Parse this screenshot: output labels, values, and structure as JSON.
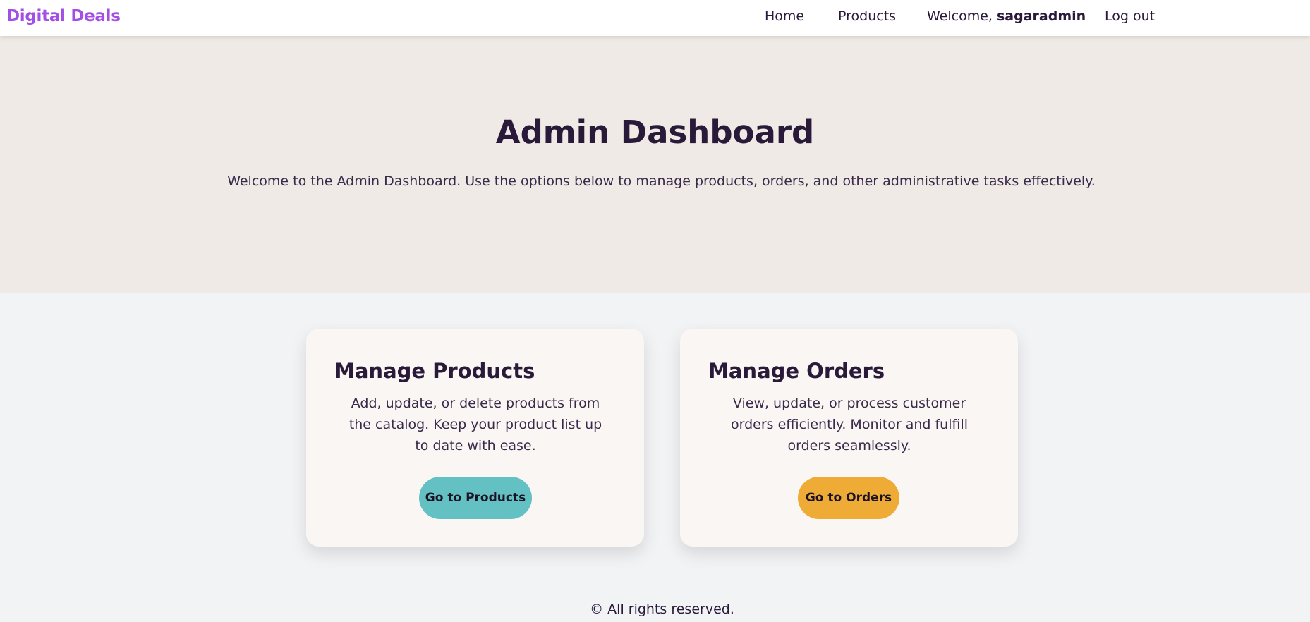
{
  "nav": {
    "brand": "Digital Deals",
    "home": "Home",
    "products": "Products",
    "welcome_prefix": "Welcome, ",
    "username": "sagaradmin",
    "logout": "Log out"
  },
  "hero": {
    "title": "Admin Dashboard",
    "subtitle": "Welcome to the Admin Dashboard. Use the options below to manage products, orders, and other administrative tasks effectively."
  },
  "cards": [
    {
      "title": "Manage Products",
      "description": "Add, update, or delete products from the catalog. Keep your product list up to date with ease.",
      "button": "Go to Products",
      "button_color": "#63c1c3"
    },
    {
      "title": "Manage Orders",
      "description": "View, update, or process customer orders efficiently. Monitor and fulfill orders seamlessly.",
      "button": "Go to Orders",
      "button_color": "#eeac37"
    }
  ],
  "footer": {
    "text": "© All rights reserved."
  },
  "colors": {
    "brand": "#a34ee6",
    "hero_bg": "#efeae6",
    "page_bg": "#f2f3f5",
    "card_bg": "#faf6f4",
    "text": "#2a1a3a"
  }
}
